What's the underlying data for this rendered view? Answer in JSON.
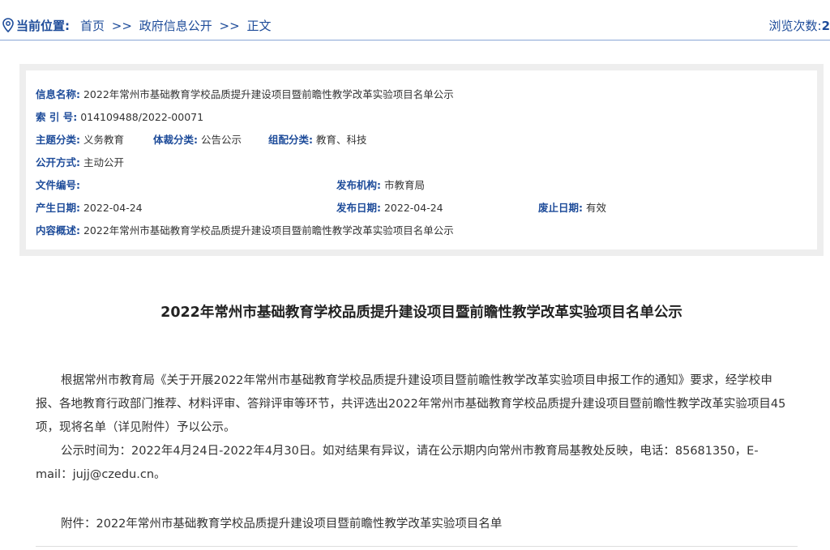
{
  "breadcrumb": {
    "label": "当前位置:",
    "items": [
      {
        "text": "首页"
      },
      {
        "text": ">>"
      },
      {
        "text": "政府信息公开"
      },
      {
        "text": ">>"
      },
      {
        "text": "正文"
      }
    ],
    "views_label": "浏览次数:",
    "views_value": "2"
  },
  "info": {
    "name_label": "信息名称:",
    "name_value": "2022年常州市基础教育学校品质提升建设项目暨前瞻性教学改革实验项目名单公示",
    "index_label": "索 引 号:",
    "index_value": "014109488/2022-00071",
    "topic_label": "主题分类:",
    "topic_value": "义务教育",
    "genre_label": "体裁分类:",
    "genre_value": "公告公示",
    "combo_label": "组配分类:",
    "combo_value": "教育、科技",
    "open_label": "公开方式:",
    "open_value": "主动公开",
    "docno_label": "文件编号:",
    "docno_value": "",
    "org_label": "发布机构:",
    "org_value": "市教育局",
    "created_label": "产生日期:",
    "created_value": "2022-04-24",
    "published_label": "发布日期:",
    "published_value": "2022-04-24",
    "expire_label": "废止日期:",
    "expire_value": "有效",
    "summary_label": "内容概述:",
    "summary_value": "2022年常州市基础教育学校品质提升建设项目暨前瞻性教学改革实验项目名单公示"
  },
  "article": {
    "title": "2022年常州市基础教育学校品质提升建设项目暨前瞻性教学改革实验项目名单公示",
    "para1": "根据常州市教育局《关于开展2022年常州市基础教育学校品质提升建设项目暨前瞻性教学改革实验项目申报工作的通知》要求，经学校申报、各地教育行政部门推荐、材料评审、答辩评审等环节，共评选出2022年常州市基础教育学校品质提升建设项目暨前瞻性教学改革实验项目45项，现将名单（详见附件）予以公示。",
    "para2": "公示时间为：2022年4月24日-2022年4月30日。如对结果有异议，请在公示期内向常州市教育局基教处反映，电话：85681350，E-mail：jujj@czedu.cn。",
    "attachment": "附件：2022年常州市基础教育学校品质提升建设项目暨前瞻性教学改革实验项目名单"
  },
  "colors": {
    "accent": "#1e4c9a",
    "box_bg": "#eeeeee"
  }
}
